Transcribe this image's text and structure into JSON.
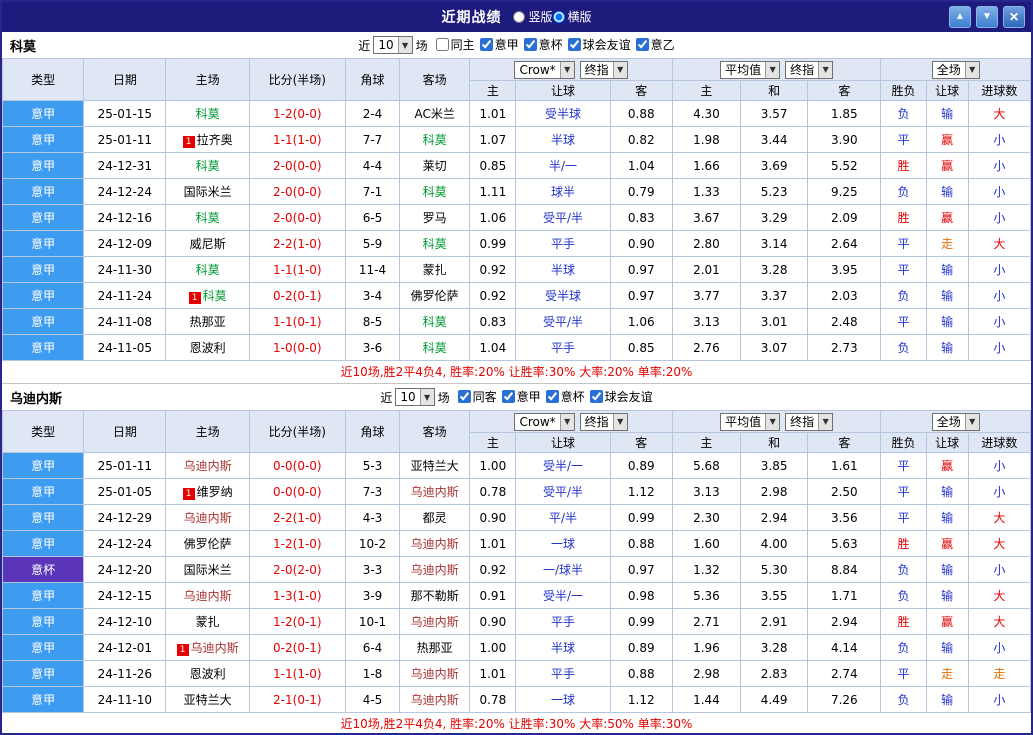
{
  "icons": {
    "up": "▲",
    "down": "▼",
    "close": "✕",
    "dropdown": "▼"
  },
  "colors": {
    "topbar_bg": "#1d1b7c",
    "league_badge_blue": "#3d9bf0",
    "cup_badge_purple": "#5a35b8",
    "win_red": "#e60000",
    "loss_blue": "#2233cc",
    "void_orange": "#e07000",
    "focus_team_1_green": "#009933",
    "focus_team_2_red": "#aa3333"
  },
  "topbar": {
    "title": "近期战绩",
    "layout_options": [
      {
        "label": "竖版",
        "selected": false
      },
      {
        "label": "横版",
        "selected": true
      }
    ]
  },
  "header": {
    "recent_prefix": "近",
    "recent_suffix": "场",
    "columns": [
      "类型",
      "日期",
      "主场",
      "比分(半场)",
      "角球",
      "客场",
      "主",
      "让球",
      "客",
      "主",
      "和",
      "客",
      "胜负",
      "让球",
      "进球数"
    ],
    "odds_source": "Crow*",
    "odds_final": "终指",
    "avg_label": "平均值",
    "avg_final": "终指",
    "fulltime_label": "全场"
  },
  "tables": [
    {
      "team": "科莫",
      "recent_count": "10",
      "filters": [
        {
          "label": "同主",
          "checked": false
        },
        {
          "label": "意甲",
          "checked": true
        },
        {
          "label": "意杯",
          "checked": true
        },
        {
          "label": "球会友谊",
          "checked": true
        },
        {
          "label": "意乙",
          "checked": true
        }
      ],
      "rows": [
        {
          "league": "意甲",
          "league_type": "league",
          "date": "25-01-15",
          "home": "科莫",
          "home_card": "",
          "home_focus": true,
          "score": "1-2(0-0)",
          "corners": "2-4",
          "away": "AC米兰",
          "away_card": "",
          "away_focus": false,
          "odds": [
            "1.01",
            "受半球",
            "0.88"
          ],
          "avg": [
            "4.30",
            "3.57",
            "1.85"
          ],
          "results": [
            "负",
            "输",
            "大"
          ]
        },
        {
          "league": "意甲",
          "league_type": "league",
          "date": "25-01-11",
          "home": "拉齐奥",
          "home_card": "1",
          "home_focus": false,
          "score": "1-1(1-0)",
          "corners": "7-7",
          "away": "科莫",
          "away_card": "",
          "away_focus": true,
          "odds": [
            "1.07",
            "半球",
            "0.82"
          ],
          "avg": [
            "1.98",
            "3.44",
            "3.90"
          ],
          "results": [
            "平",
            "赢",
            "小"
          ]
        },
        {
          "league": "意甲",
          "league_type": "league",
          "date": "24-12-31",
          "home": "科莫",
          "home_card": "",
          "home_focus": true,
          "score": "2-0(0-0)",
          "corners": "4-4",
          "away": "莱切",
          "away_card": "",
          "away_focus": false,
          "odds": [
            "0.85",
            "半/一",
            "1.04"
          ],
          "avg": [
            "1.66",
            "3.69",
            "5.52"
          ],
          "results": [
            "胜",
            "赢",
            "小"
          ]
        },
        {
          "league": "意甲",
          "league_type": "league",
          "date": "24-12-24",
          "home": "国际米兰",
          "home_card": "",
          "home_focus": false,
          "score": "2-0(0-0)",
          "corners": "7-1",
          "away": "科莫",
          "away_card": "",
          "away_focus": true,
          "odds": [
            "1.11",
            "球半",
            "0.79"
          ],
          "avg": [
            "1.33",
            "5.23",
            "9.25"
          ],
          "results": [
            "负",
            "输",
            "小"
          ]
        },
        {
          "league": "意甲",
          "league_type": "league",
          "date": "24-12-16",
          "home": "科莫",
          "home_card": "",
          "home_focus": true,
          "score": "2-0(0-0)",
          "corners": "6-5",
          "away": "罗马",
          "away_card": "",
          "away_focus": false,
          "odds": [
            "1.06",
            "受平/半",
            "0.83"
          ],
          "avg": [
            "3.67",
            "3.29",
            "2.09"
          ],
          "results": [
            "胜",
            "赢",
            "小"
          ]
        },
        {
          "league": "意甲",
          "league_type": "league",
          "date": "24-12-09",
          "home": "威尼斯",
          "home_card": "",
          "home_focus": false,
          "score": "2-2(1-0)",
          "corners": "5-9",
          "away": "科莫",
          "away_card": "",
          "away_focus": true,
          "odds": [
            "0.99",
            "平手",
            "0.90"
          ],
          "avg": [
            "2.80",
            "3.14",
            "2.64"
          ],
          "results": [
            "平",
            "走",
            "大"
          ]
        },
        {
          "league": "意甲",
          "league_type": "league",
          "date": "24-11-30",
          "home": "科莫",
          "home_card": "",
          "home_focus": true,
          "score": "1-1(1-0)",
          "corners": "11-4",
          "away": "蒙扎",
          "away_card": "",
          "away_focus": false,
          "odds": [
            "0.92",
            "半球",
            "0.97"
          ],
          "avg": [
            "2.01",
            "3.28",
            "3.95"
          ],
          "results": [
            "平",
            "输",
            "小"
          ]
        },
        {
          "league": "意甲",
          "league_type": "league",
          "date": "24-11-24",
          "home": "科莫",
          "home_card": "1",
          "home_focus": true,
          "score": "0-2(0-1)",
          "corners": "3-4",
          "away": "佛罗伦萨",
          "away_card": "",
          "away_focus": false,
          "odds": [
            "0.92",
            "受半球",
            "0.97"
          ],
          "avg": [
            "3.77",
            "3.37",
            "2.03"
          ],
          "results": [
            "负",
            "输",
            "小"
          ]
        },
        {
          "league": "意甲",
          "league_type": "league",
          "date": "24-11-08",
          "home": "热那亚",
          "home_card": "",
          "home_focus": false,
          "score": "1-1(0-1)",
          "corners": "8-5",
          "away": "科莫",
          "away_card": "",
          "away_focus": true,
          "odds": [
            "0.83",
            "受平/半",
            "1.06"
          ],
          "avg": [
            "3.13",
            "3.01",
            "2.48"
          ],
          "results": [
            "平",
            "输",
            "小"
          ]
        },
        {
          "league": "意甲",
          "league_type": "league",
          "date": "24-11-05",
          "home": "恩波利",
          "home_card": "",
          "home_focus": false,
          "score": "1-0(0-0)",
          "corners": "3-6",
          "away": "科莫",
          "away_card": "",
          "away_focus": true,
          "odds": [
            "1.04",
            "平手",
            "0.85"
          ],
          "avg": [
            "2.76",
            "3.07",
            "2.73"
          ],
          "results": [
            "负",
            "输",
            "小"
          ]
        }
      ],
      "summary": "近10场,胜2平4负4, 胜率:20% 让胜率:30% 大率:20% 单率:20%"
    },
    {
      "team": "乌迪内斯",
      "recent_count": "10",
      "filters": [
        {
          "label": "同客",
          "checked": true
        },
        {
          "label": "意甲",
          "checked": true
        },
        {
          "label": "意杯",
          "checked": true
        },
        {
          "label": "球会友谊",
          "checked": true
        }
      ],
      "rows": [
        {
          "league": "意甲",
          "league_type": "league",
          "date": "25-01-11",
          "home": "乌迪内斯",
          "home_card": "",
          "home_focus": true,
          "score": "0-0(0-0)",
          "corners": "5-3",
          "away": "亚特兰大",
          "away_card": "",
          "away_focus": false,
          "odds": [
            "1.00",
            "受半/一",
            "0.89"
          ],
          "avg": [
            "5.68",
            "3.85",
            "1.61"
          ],
          "results": [
            "平",
            "赢",
            "小"
          ]
        },
        {
          "league": "意甲",
          "league_type": "league",
          "date": "25-01-05",
          "home": "维罗纳",
          "home_card": "1",
          "home_focus": false,
          "score": "0-0(0-0)",
          "corners": "7-3",
          "away": "乌迪内斯",
          "away_card": "",
          "away_focus": true,
          "odds": [
            "0.78",
            "受平/半",
            "1.12"
          ],
          "avg": [
            "3.13",
            "2.98",
            "2.50"
          ],
          "results": [
            "平",
            "输",
            "小"
          ]
        },
        {
          "league": "意甲",
          "league_type": "league",
          "date": "24-12-29",
          "home": "乌迪内斯",
          "home_card": "",
          "home_focus": true,
          "score": "2-2(1-0)",
          "corners": "4-3",
          "away": "都灵",
          "away_card": "",
          "away_focus": false,
          "odds": [
            "0.90",
            "平/半",
            "0.99"
          ],
          "avg": [
            "2.30",
            "2.94",
            "3.56"
          ],
          "results": [
            "平",
            "输",
            "大"
          ]
        },
        {
          "league": "意甲",
          "league_type": "league",
          "date": "24-12-24",
          "home": "佛罗伦萨",
          "home_card": "",
          "home_focus": false,
          "score": "1-2(1-0)",
          "corners": "10-2",
          "away": "乌迪内斯",
          "away_card": "",
          "away_focus": true,
          "odds": [
            "1.01",
            "一球",
            "0.88"
          ],
          "avg": [
            "1.60",
            "4.00",
            "5.63"
          ],
          "results": [
            "胜",
            "赢",
            "大"
          ]
        },
        {
          "league": "意杯",
          "league_type": "cup",
          "date": "24-12-20",
          "home": "国际米兰",
          "home_card": "",
          "home_focus": false,
          "score": "2-0(2-0)",
          "corners": "3-3",
          "away": "乌迪内斯",
          "away_card": "",
          "away_focus": true,
          "odds": [
            "0.92",
            "一/球半",
            "0.97"
          ],
          "avg": [
            "1.32",
            "5.30",
            "8.84"
          ],
          "results": [
            "负",
            "输",
            "小"
          ]
        },
        {
          "league": "意甲",
          "league_type": "league",
          "date": "24-12-15",
          "home": "乌迪内斯",
          "home_card": "",
          "home_focus": true,
          "score": "1-3(1-0)",
          "corners": "3-9",
          "away": "那不勒斯",
          "away_card": "",
          "away_focus": false,
          "odds": [
            "0.91",
            "受半/一",
            "0.98"
          ],
          "avg": [
            "5.36",
            "3.55",
            "1.71"
          ],
          "results": [
            "负",
            "输",
            "大"
          ]
        },
        {
          "league": "意甲",
          "league_type": "league",
          "date": "24-12-10",
          "home": "蒙扎",
          "home_card": "",
          "home_focus": false,
          "score": "1-2(0-1)",
          "corners": "10-1",
          "away": "乌迪内斯",
          "away_card": "",
          "away_focus": true,
          "odds": [
            "0.90",
            "平手",
            "0.99"
          ],
          "avg": [
            "2.71",
            "2.91",
            "2.94"
          ],
          "results": [
            "胜",
            "赢",
            "大"
          ]
        },
        {
          "league": "意甲",
          "league_type": "league",
          "date": "24-12-01",
          "home": "乌迪内斯",
          "home_card": "1",
          "home_focus": true,
          "score": "0-2(0-1)",
          "corners": "6-4",
          "away": "热那亚",
          "away_card": "",
          "away_focus": false,
          "odds": [
            "1.00",
            "半球",
            "0.89"
          ],
          "avg": [
            "1.96",
            "3.28",
            "4.14"
          ],
          "results": [
            "负",
            "输",
            "小"
          ]
        },
        {
          "league": "意甲",
          "league_type": "league",
          "date": "24-11-26",
          "home": "恩波利",
          "home_card": "",
          "home_focus": false,
          "score": "1-1(1-0)",
          "corners": "1-8",
          "away": "乌迪内斯",
          "away_card": "",
          "away_focus": true,
          "odds": [
            "1.01",
            "平手",
            "0.88"
          ],
          "avg": [
            "2.98",
            "2.83",
            "2.74"
          ],
          "results": [
            "平",
            "走",
            "走"
          ]
        },
        {
          "league": "意甲",
          "league_type": "league",
          "date": "24-11-10",
          "home": "亚特兰大",
          "home_card": "",
          "home_focus": false,
          "score": "2-1(0-1)",
          "corners": "4-5",
          "away": "乌迪内斯",
          "away_card": "",
          "away_focus": true,
          "odds": [
            "0.78",
            "一球",
            "1.12"
          ],
          "avg": [
            "1.44",
            "4.49",
            "7.26"
          ],
          "results": [
            "负",
            "输",
            "小"
          ]
        }
      ],
      "summary": "近10场,胜2平4负4, 胜率:20% 让胜率:30% 大率:50% 单率:30%"
    }
  ]
}
